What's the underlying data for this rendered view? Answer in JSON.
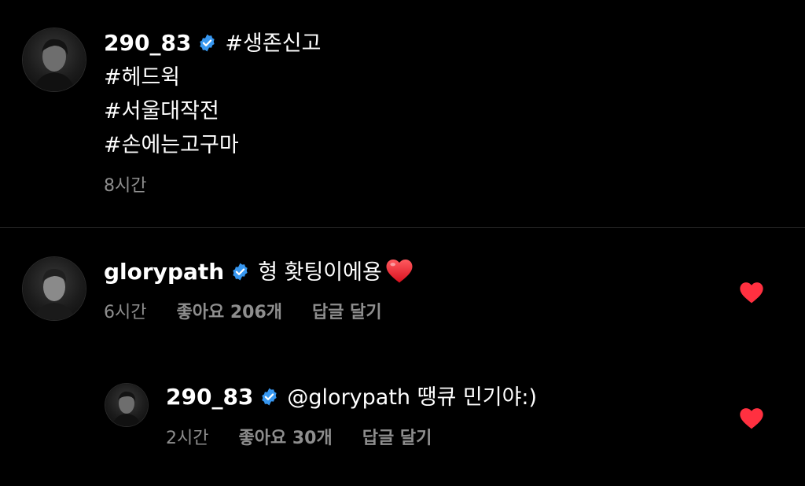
{
  "colors": {
    "background": "#000000",
    "text": "#ffffff",
    "meta_text": "#8e8e8e",
    "verified_badge": "#3797f0",
    "heart": "#ff3040",
    "divider": "#262626"
  },
  "post": {
    "username": "290_83",
    "verified": true,
    "caption_lines": [
      "#생존신고",
      "#헤드윅",
      "#서울대작전",
      "#손에는고구마"
    ],
    "time": "8시간"
  },
  "comments": [
    {
      "username": "glorypath",
      "verified": true,
      "text": "형 홧팅이에용",
      "emoji": "red-heart-emoji",
      "time": "6시간",
      "likes": "좋아요 206개",
      "reply_label": "답글 달기",
      "liked": true
    },
    {
      "username": "290_83",
      "verified": true,
      "text": "@glorypath 땡큐 민기야:)",
      "time": "2시간",
      "likes": "좋아요 30개",
      "reply_label": "답글 달기",
      "liked": true
    }
  ]
}
